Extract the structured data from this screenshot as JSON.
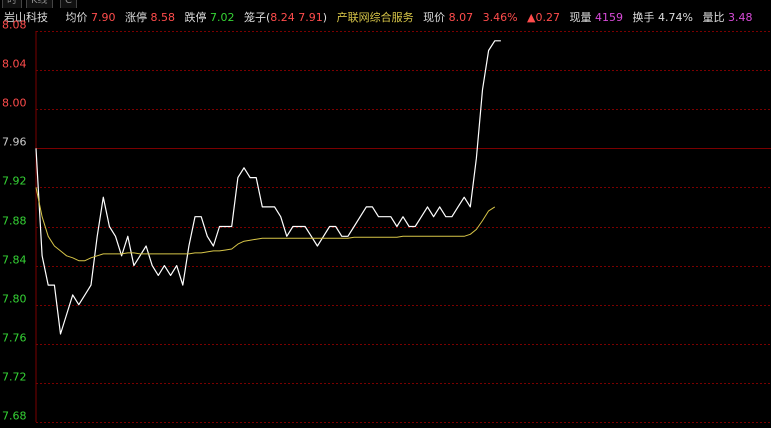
{
  "tabs": [
    "时",
    "K线",
    "C"
  ],
  "header": {
    "stock_name": "岩山科技",
    "avg_label": "均价",
    "avg_value": "7.90",
    "limit_up_label": "涨停",
    "limit_up_value": "8.58",
    "limit_down_label": "跌停",
    "limit_down_value": "7.02",
    "cage_label": "笼子(",
    "cage_high": "8.24",
    "cage_low": "7.91",
    "cage_close": ")",
    "sector": "产联网综合服务",
    "price_label": "现价",
    "price_value": "8.07",
    "change_pct": "3.46%",
    "change_value": "▲0.27",
    "volume_label": "现量",
    "volume_value": "4159",
    "turnover_label": "换手",
    "turnover_value": "4.74%",
    "ratio_label": "量比",
    "ratio_value": "3.48"
  },
  "colors": {
    "up": "#ff4c4c",
    "down": "#35d335",
    "price_line": "#ffffff",
    "avg_line": "#d7c548",
    "grid": "#7a0000",
    "highlight": "#d84bd8"
  },
  "chart_data": {
    "type": "line",
    "ylim": [
      7.68,
      8.08
    ],
    "yticks": [
      "8.08",
      "8.04",
      "8.00",
      "7.96",
      "7.92",
      "7.88",
      "7.84",
      "7.80",
      "7.76",
      "7.72",
      "7.68"
    ],
    "reference": 7.96,
    "x": [
      0,
      1,
      2,
      3,
      4,
      5,
      6,
      7,
      8,
      9,
      10,
      11,
      12,
      13,
      14,
      15,
      16,
      17,
      18,
      19,
      20,
      21,
      22,
      23,
      24,
      25,
      26,
      27,
      28,
      29,
      30,
      31,
      32,
      33,
      34,
      35,
      36,
      37,
      38,
      39,
      40,
      41,
      42,
      43,
      44,
      45,
      46,
      47,
      48,
      49,
      50,
      51,
      52,
      53,
      54,
      55,
      56,
      57,
      58,
      59,
      60,
      61,
      62,
      63,
      64,
      65,
      66,
      67,
      68,
      69,
      70,
      71,
      72,
      73,
      74,
      75,
      76,
      77,
      78,
      79,
      80,
      81,
      82,
      83,
      84,
      85,
      86,
      87,
      88,
      89,
      90,
      91,
      92,
      93,
      94,
      95,
      96,
      97,
      98,
      99,
      100,
      101,
      102,
      103,
      104,
      105,
      106,
      107,
      108,
      109,
      110,
      111,
      112,
      113,
      114,
      115,
      116,
      117,
      118,
      119,
      120
    ],
    "series": [
      {
        "values": [
          7.96,
          7.85,
          7.82,
          7.82,
          7.77,
          7.79,
          7.81,
          7.8,
          7.81,
          7.82,
          7.87,
          7.91,
          7.88,
          7.87,
          7.85,
          7.87,
          7.84,
          7.85,
          7.86,
          7.84,
          7.83,
          7.84,
          7.83,
          7.84,
          7.82,
          7.86,
          7.89,
          7.89,
          7.87,
          7.86,
          7.88,
          7.88,
          7.88,
          7.93,
          7.94,
          7.93,
          7.93,
          7.9,
          7.9,
          7.9,
          7.89,
          7.87,
          7.88,
          7.88,
          7.88,
          7.87,
          7.86,
          7.87,
          7.88,
          7.88,
          7.87,
          7.87,
          7.88,
          7.89,
          7.9,
          7.9,
          7.89,
          7.89,
          7.89,
          7.88,
          7.89,
          7.88,
          7.88,
          7.89,
          7.9,
          7.89,
          7.9,
          7.89,
          7.89,
          7.9,
          7.91,
          7.9,
          7.95,
          8.02,
          8.06,
          8.07,
          8.07
        ]
      },
      {
        "values": [
          7.92,
          7.89,
          7.87,
          7.86,
          7.855,
          7.85,
          7.848,
          7.845,
          7.845,
          7.848,
          7.85,
          7.852,
          7.852,
          7.852,
          7.852,
          7.853,
          7.853,
          7.852,
          7.852,
          7.852,
          7.852,
          7.852,
          7.852,
          7.852,
          7.852,
          7.852,
          7.853,
          7.853,
          7.854,
          7.855,
          7.855,
          7.856,
          7.857,
          7.862,
          7.865,
          7.866,
          7.867,
          7.868,
          7.868,
          7.868,
          7.868,
          7.868,
          7.868,
          7.868,
          7.868,
          7.868,
          7.868,
          7.868,
          7.868,
          7.868,
          7.868,
          7.868,
          7.869,
          7.869,
          7.869,
          7.869,
          7.869,
          7.869,
          7.869,
          7.869,
          7.87,
          7.87,
          7.87,
          7.87,
          7.87,
          7.87,
          7.87,
          7.87,
          7.87,
          7.87,
          7.87,
          7.872,
          7.877,
          7.886,
          7.896,
          7.9
        ]
      }
    ]
  }
}
